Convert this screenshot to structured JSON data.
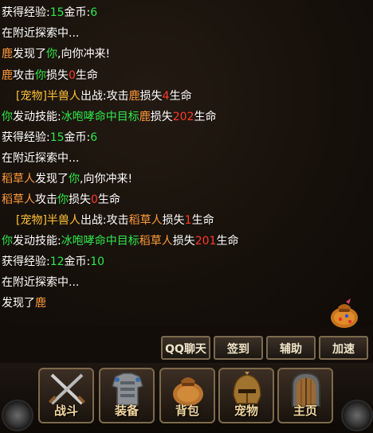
{
  "colors": {
    "white": "#ffffff",
    "green": "#2ee84a",
    "orange": "#ff9a3c",
    "red": "#ff3a2a",
    "pet": "#ffc23a"
  },
  "log": [
    [
      {
        "t": "获得经验:",
        "c": "white"
      },
      {
        "t": "15",
        "c": "green"
      },
      {
        "t": "金币:",
        "c": "white"
      },
      {
        "t": "6",
        "c": "green"
      }
    ],
    [
      {
        "t": "在附近探索中...",
        "c": "white"
      }
    ],
    [
      {
        "t": "鹿",
        "c": "orange"
      },
      {
        "t": "发现了",
        "c": "white"
      },
      {
        "t": "你",
        "c": "green"
      },
      {
        "t": ",向你冲来!",
        "c": "white"
      }
    ],
    [
      {
        "t": "鹿",
        "c": "orange"
      },
      {
        "t": "攻击",
        "c": "white"
      },
      {
        "t": "你",
        "c": "green"
      },
      {
        "t": "损失",
        "c": "white"
      },
      {
        "t": "0",
        "c": "red"
      },
      {
        "t": "生命",
        "c": "white"
      }
    ],
    [
      {
        "t": "[宠物]半兽人",
        "c": "pet"
      },
      {
        "t": "出战:攻击",
        "c": "white"
      },
      {
        "t": "鹿",
        "c": "orange"
      },
      {
        "t": "损失",
        "c": "white"
      },
      {
        "t": "4",
        "c": "red"
      },
      {
        "t": "生命",
        "c": "white"
      }
    ],
    [
      {
        "t": "你",
        "c": "green"
      },
      {
        "t": "发动技能:",
        "c": "white"
      },
      {
        "t": "冰咆哮命中目标",
        "c": "green"
      },
      {
        "t": "鹿",
        "c": "orange"
      },
      {
        "t": "损失",
        "c": "white"
      },
      {
        "t": "202",
        "c": "red"
      },
      {
        "t": "生命",
        "c": "white"
      }
    ],
    [
      {
        "t": "获得经验:",
        "c": "white"
      },
      {
        "t": "15",
        "c": "green"
      },
      {
        "t": "金币:",
        "c": "white"
      },
      {
        "t": "6",
        "c": "green"
      }
    ],
    [
      {
        "t": "在附近探索中...",
        "c": "white"
      }
    ],
    [
      {
        "t": "稻草人",
        "c": "orange"
      },
      {
        "t": "发现了",
        "c": "white"
      },
      {
        "t": "你",
        "c": "green"
      },
      {
        "t": ",向你冲来!",
        "c": "white"
      }
    ],
    [
      {
        "t": "稻草人",
        "c": "orange"
      },
      {
        "t": "攻击",
        "c": "white"
      },
      {
        "t": "你",
        "c": "green"
      },
      {
        "t": "损失",
        "c": "white"
      },
      {
        "t": "0",
        "c": "red"
      },
      {
        "t": "生命",
        "c": "white"
      }
    ],
    [
      {
        "t": "[宠物]半兽人",
        "c": "pet"
      },
      {
        "t": "出战:攻击",
        "c": "white"
      },
      {
        "t": "稻草人",
        "c": "orange"
      },
      {
        "t": "损失",
        "c": "white"
      },
      {
        "t": "1",
        "c": "red"
      },
      {
        "t": "生命",
        "c": "white"
      }
    ],
    [
      {
        "t": "你",
        "c": "green"
      },
      {
        "t": "发动技能:",
        "c": "white"
      },
      {
        "t": "冰咆哮命中目标",
        "c": "green"
      },
      {
        "t": "稻草人",
        "c": "orange"
      },
      {
        "t": "损失",
        "c": "white"
      },
      {
        "t": "201",
        "c": "red"
      },
      {
        "t": "生命",
        "c": "white"
      }
    ],
    [
      {
        "t": "获得经验:",
        "c": "white"
      },
      {
        "t": "12",
        "c": "green"
      },
      {
        "t": "金币:",
        "c": "white"
      },
      {
        "t": "10",
        "c": "green"
      }
    ],
    [
      {
        "t": "在附近探索中...",
        "c": "white"
      }
    ],
    [
      {
        "t": "发现了",
        "c": "white"
      },
      {
        "t": "鹿",
        "c": "orange"
      }
    ]
  ],
  "actions": {
    "qq": "QQ聊天",
    "sign": "签到",
    "assist": "辅助",
    "speed": "加速"
  },
  "nav": {
    "battle": "战斗",
    "equip": "装备",
    "bag": "背包",
    "pet": "宠物",
    "home": "主页"
  },
  "icons": {
    "bag": "treasure-bag-icon",
    "battle": "crossed-swords-icon",
    "equip": "armor-icon",
    "backpack": "backpack-icon",
    "pet": "helmet-icon",
    "home": "door-icon"
  }
}
